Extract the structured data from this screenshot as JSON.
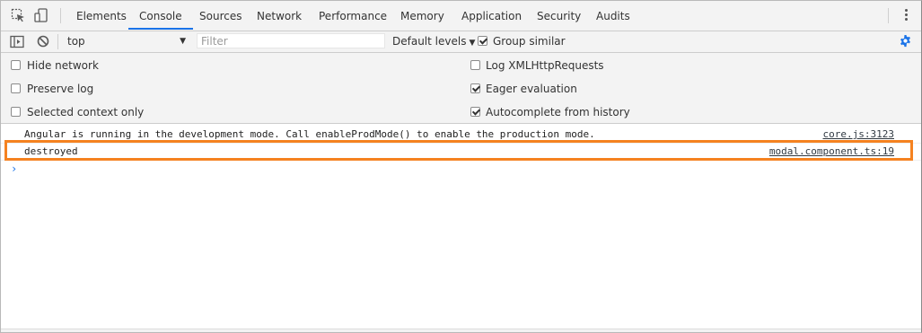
{
  "tabs": [
    {
      "label": "Elements"
    },
    {
      "label": "Console"
    },
    {
      "label": "Sources"
    },
    {
      "label": "Network"
    },
    {
      "label": "Performance"
    },
    {
      "label": "Memory"
    },
    {
      "label": "Application"
    },
    {
      "label": "Security"
    },
    {
      "label": "Audits"
    }
  ],
  "active_tab": "Console",
  "toolbar": {
    "context": "top",
    "filter_placeholder": "Filter",
    "levels": "Default levels",
    "group_similar": "Group similar",
    "group_similar_checked": true
  },
  "settings": {
    "left": [
      {
        "label": "Hide network",
        "checked": false
      },
      {
        "label": "Preserve log",
        "checked": false
      },
      {
        "label": "Selected context only",
        "checked": false
      }
    ],
    "right": [
      {
        "label": "Log XMLHttpRequests",
        "checked": false
      },
      {
        "label": "Eager evaluation",
        "checked": true
      },
      {
        "label": "Autocomplete from history",
        "checked": true
      }
    ]
  },
  "messages": [
    {
      "text": "Angular is running in the development mode. Call enableProdMode() to enable the production mode.",
      "source": "core.js:3123"
    },
    {
      "text": "destroyed",
      "source": "modal.component.ts:19"
    }
  ],
  "prompt": "›",
  "colors": {
    "accent": "#1a73e8",
    "highlight": "#f58220",
    "panel": "#f3f3f3"
  },
  "icons": [
    "inspect-element-icon",
    "device-toolbar-icon",
    "sidebar-toggle-icon",
    "clear-console-icon",
    "settings-gear-icon",
    "more-options-icon"
  ]
}
